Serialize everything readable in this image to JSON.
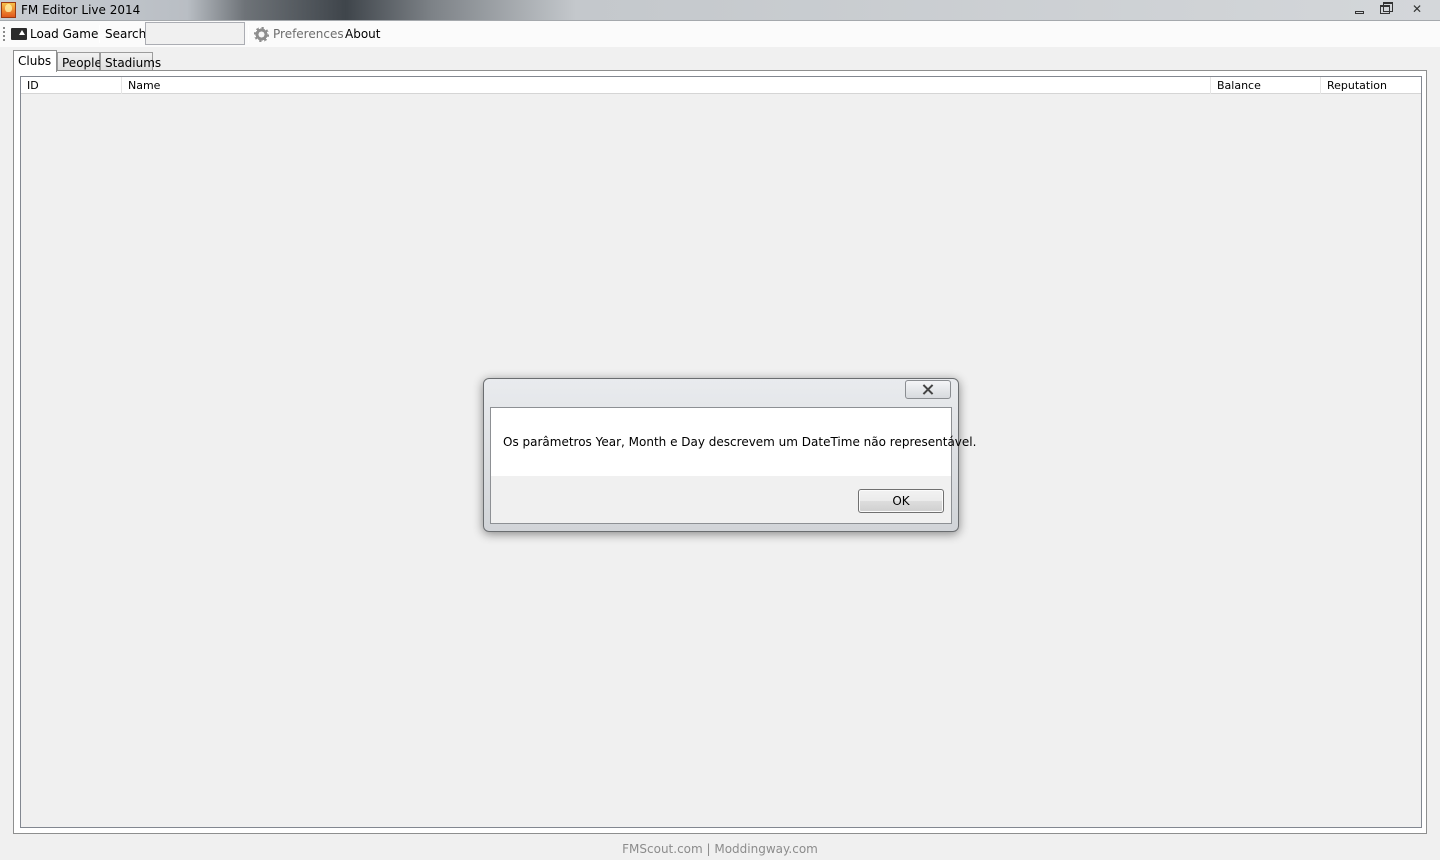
{
  "window": {
    "title": "FM Editor Live 2014",
    "app_icon": "fm-editor-icon",
    "controls": [
      "minimize-icon",
      "maximize-icon",
      "close-icon"
    ]
  },
  "toolbar": {
    "load_game_label": "Load Game",
    "load_game_icon": "load-folder-icon",
    "search_label": "Search",
    "search_value": "",
    "preferences_label": "Preferences",
    "preferences_icon": "gear-icon",
    "about_label": "About"
  },
  "tabs": [
    {
      "label": "Clubs",
      "active": true
    },
    {
      "label": "People",
      "active": false
    },
    {
      "label": "Stadiums",
      "active": false
    }
  ],
  "grid": {
    "columns": [
      "ID",
      "Name",
      "Balance",
      "Reputation"
    ],
    "rows": []
  },
  "dialog": {
    "message": "Os parâmetros Year, Month e Day descrevem um DateTime não representável.",
    "ok_label": "OK",
    "close_icon": "close-icon"
  },
  "footer": {
    "text": "FMScout.com | Moddingway.com"
  }
}
